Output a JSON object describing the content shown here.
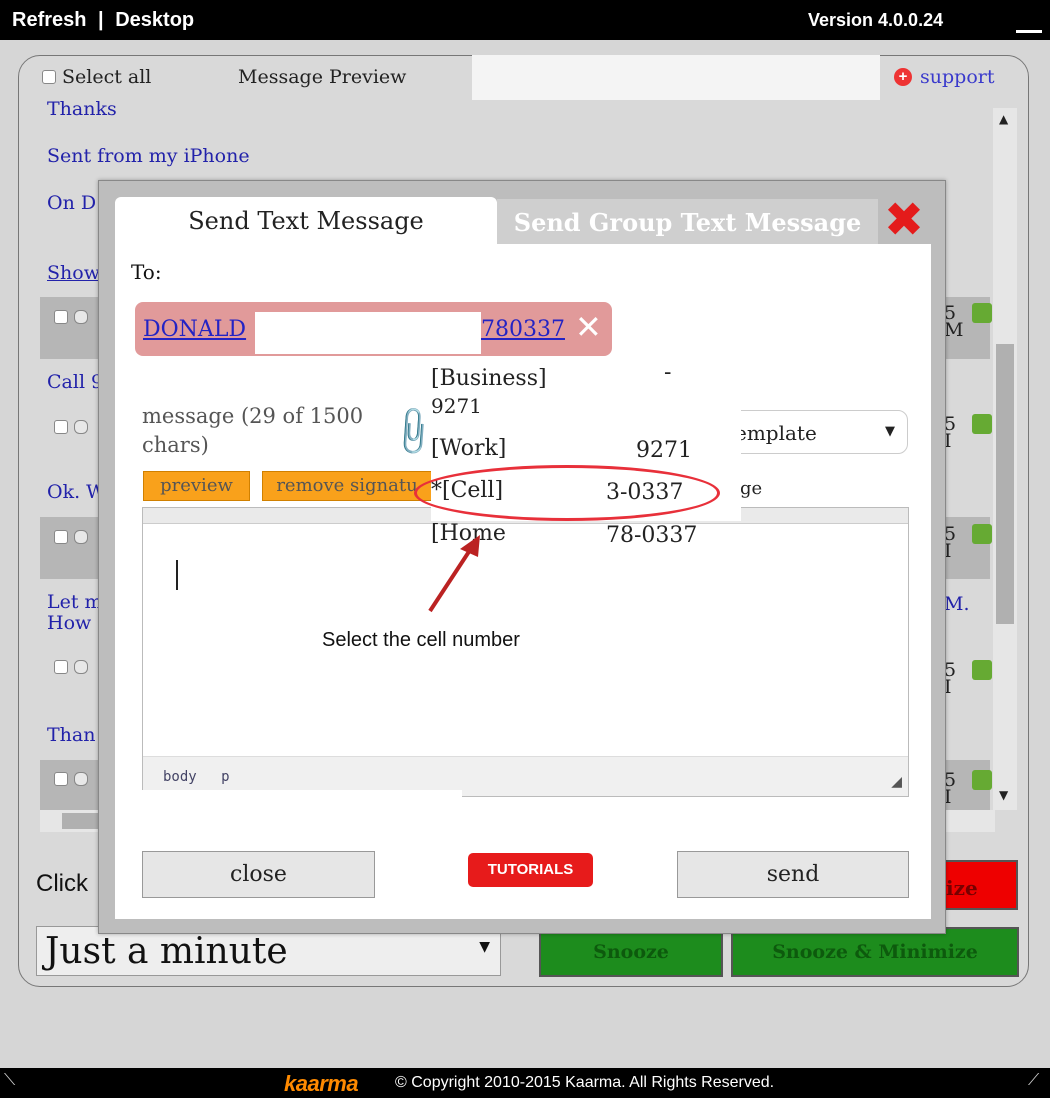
{
  "topbar": {
    "refresh": "Refresh",
    "separator": "|",
    "desktop": "Desktop",
    "version": "Version 4.0.0.24"
  },
  "list_header": {
    "select_all": "Select all",
    "message_preview": "Message Preview",
    "support": "support"
  },
  "messages": [
    {
      "text": "Thanks"
    },
    {
      "text": "Sent from my iPhone"
    },
    {
      "text": "On D"
    },
    {
      "text": "Show"
    },
    {
      "text": "Call 9"
    },
    {
      "text": "Ok. W"
    },
    {
      "text": "Let m"
    },
    {
      "text": "How"
    },
    {
      "text": "Than"
    }
  ],
  "right_column": {
    "m_label": "M."
  },
  "bottom_bar": {
    "click_label": "Click",
    "minimize_fragment": "ize",
    "snooze_select_value": "Just a minute",
    "snooze": "Snooze",
    "snooze_minimize": "Snooze & Minimize"
  },
  "modal": {
    "tab_send": "Send Text Message",
    "tab_group": "Send Group Text Message",
    "to_label": "To:",
    "recipient_name": "DONALD",
    "recipient_number": "780337",
    "message_count": "message (29 of 1500 chars)",
    "template_value": "emplate",
    "usage_fragment": "ge",
    "preview_btn": "preview",
    "remove_signature_btn": "remove signatu",
    "editor_path": [
      "body",
      "p"
    ],
    "close_btn": "close",
    "tutorials_btn": "TUTORIALS",
    "send_btn": "send"
  },
  "dropdown": {
    "business_label": "[Business]",
    "business_num": "9271",
    "business_dash": "-",
    "work_label": "[Work]",
    "work_num": "9271",
    "cell_label": "*[Cell]",
    "cell_num": "3-0337",
    "home_label": "[Home",
    "home_num": "78-0337"
  },
  "annotation": {
    "caption": "Select the cell number"
  },
  "footer": {
    "logo": "kaarma",
    "copyright": "© Copyright 2010-2015 Kaarma.  All Rights Reserved."
  },
  "colors": {
    "accent_red": "#e41b1b",
    "link_blue": "#2323c4",
    "orange": "#f9a11b",
    "snooze_green": "#1d8c1d",
    "chip_pink": "#e19a9a"
  }
}
